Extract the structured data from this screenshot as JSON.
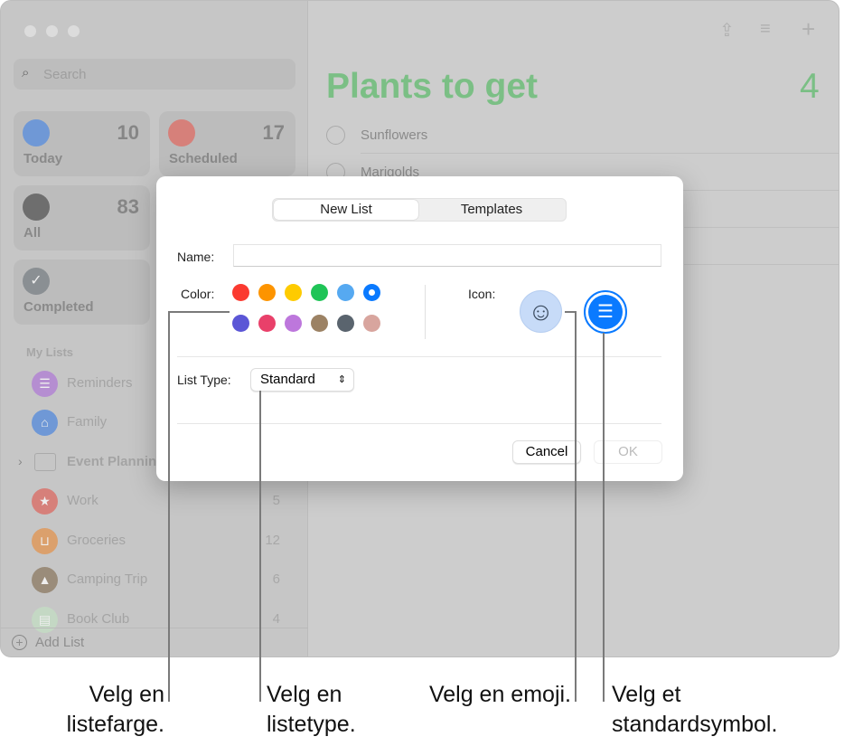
{
  "sidebar": {
    "search_placeholder": "Search",
    "smart_lists": [
      {
        "label": "Today",
        "count": "10",
        "icon": "calendar-today-icon",
        "color": "#6f98d6"
      },
      {
        "label": "Scheduled",
        "count": "17",
        "icon": "calendar-icon",
        "color": "#d6807a"
      },
      {
        "label": "All",
        "count": "83",
        "icon": "tray-icon",
        "color": "#6e6e6e"
      },
      {
        "label": "Completed",
        "count": "",
        "icon": "checkmark-icon",
        "color": "#8a8f93"
      }
    ],
    "section": "My Lists",
    "lists": [
      {
        "label": "Reminders",
        "count": "",
        "icon": "list-icon",
        "color": "#b58ed1"
      },
      {
        "label": "Family",
        "count": "",
        "icon": "house-icon",
        "color": "#6f98d6"
      },
      {
        "label": "Event Planning",
        "count": "",
        "icon": "folder-icon",
        "color": ""
      },
      {
        "label": "Work",
        "count": "5",
        "icon": "star-icon",
        "color": "#d6807a"
      },
      {
        "label": "Groceries",
        "count": "12",
        "icon": "basket-icon",
        "color": "#dba06c"
      },
      {
        "label": "Camping Trip",
        "count": "6",
        "icon": "tent-icon",
        "color": "#9a8c7a"
      },
      {
        "label": "Book Club",
        "count": "4",
        "icon": "books-emoji-icon",
        "color": "#c4d8c4"
      }
    ],
    "add_list": "Add List"
  },
  "main": {
    "title": "Plants to get",
    "count": "4",
    "items": [
      "Sunflowers",
      "Marigolds"
    ],
    "title_color": "#7bbf85"
  },
  "dialog": {
    "tabs": [
      "New List",
      "Templates"
    ],
    "selected_tab": "New List",
    "name_label": "Name:",
    "name_value": "",
    "color_label": "Color:",
    "colors": [
      "#fb3a30",
      "#fd9400",
      "#fecb00",
      "#1fc457",
      "#56a9f1",
      "#0a7aff",
      "#5b56d6",
      "#e9406a",
      "#bd77dc",
      "#9c8264",
      "#5a646e",
      "#d8a59e"
    ],
    "selected_color": "#0a7aff",
    "icon_label": "Icon:",
    "list_type_label": "List Type:",
    "list_type_value": "Standard",
    "cancel": "Cancel",
    "ok": "OK"
  },
  "callouts": {
    "color": "Velg en listefarge.",
    "type": "Velg en listetype.",
    "emoji": "Velg en emoji.",
    "symbol": "Velg et standardsymbol."
  }
}
